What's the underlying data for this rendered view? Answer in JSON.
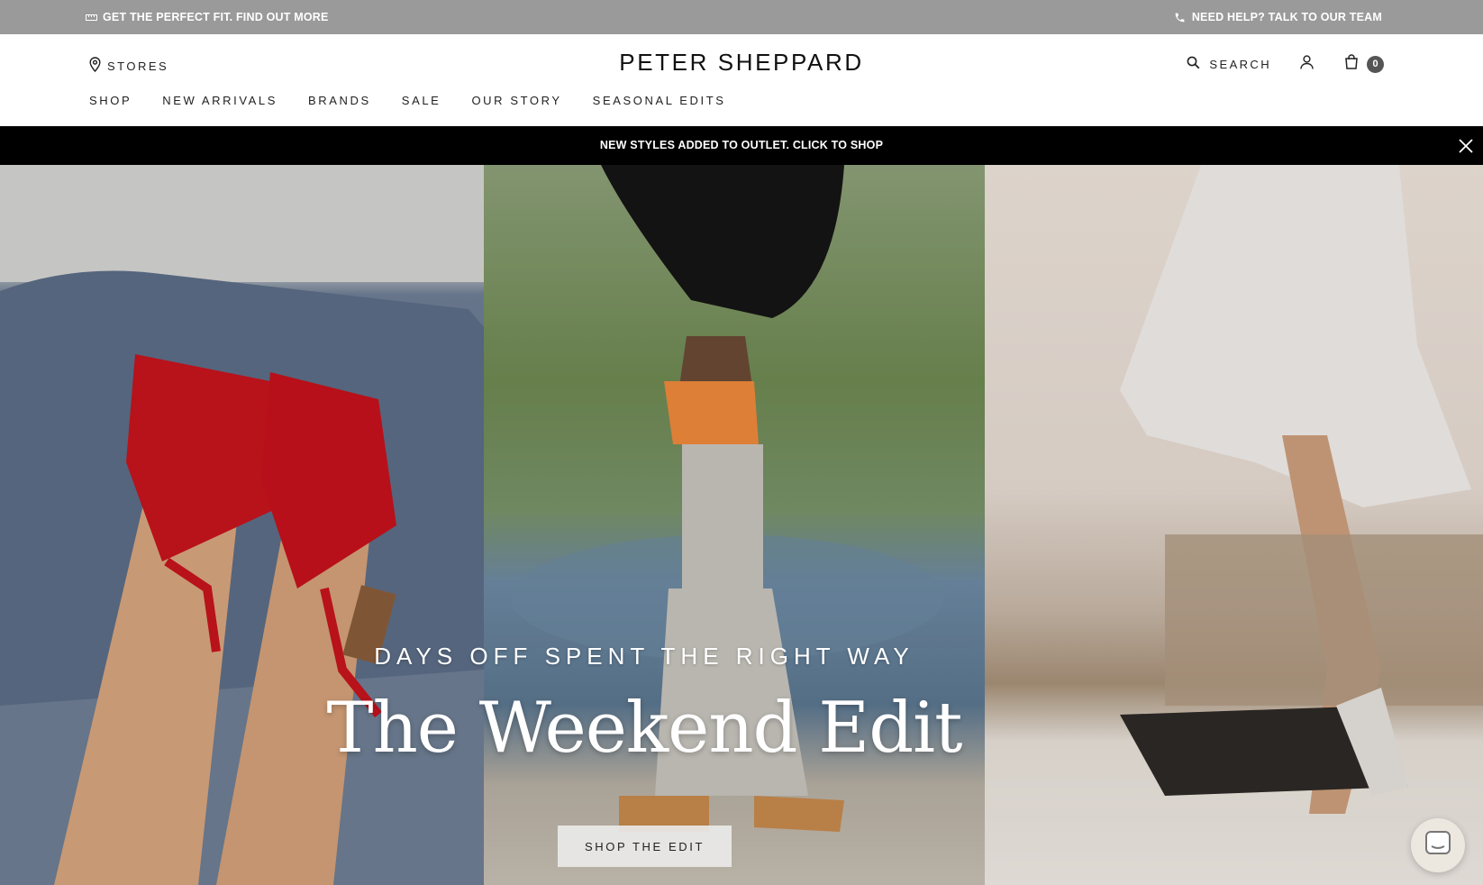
{
  "utility_bar": {
    "left_text": "GET THE PERFECT FIT. FIND OUT MORE",
    "right_text": "NEED HELP? TALK TO OUR TEAM"
  },
  "header": {
    "stores_label": "STORES",
    "logo": "PETER SHEPPARD",
    "search_label": "SEARCH",
    "bag_count": "0"
  },
  "nav": {
    "items": [
      {
        "label": "SHOP"
      },
      {
        "label": "NEW ARRIVALS"
      },
      {
        "label": "BRANDS"
      },
      {
        "label": "SALE"
      },
      {
        "label": "OUR STORY"
      },
      {
        "label": "SEASONAL EDITS"
      }
    ]
  },
  "promo": {
    "text": "NEW STYLES ADDED TO OUTLET. CLICK TO SHOP"
  },
  "hero": {
    "kicker": "DAYS OFF SPENT THE RIGHT WAY",
    "headline": "The Weekend Edit",
    "cta_label": "SHOP THE EDIT"
  },
  "colors": {
    "utility_bg": "#9a9a9a",
    "promo_bg": "#000000",
    "bag_badge": "#555555"
  },
  "icons": [
    "ruler-icon",
    "phone-icon",
    "location-pin-icon",
    "search-icon",
    "user-icon",
    "bag-icon",
    "close-icon",
    "chat-icon"
  ]
}
